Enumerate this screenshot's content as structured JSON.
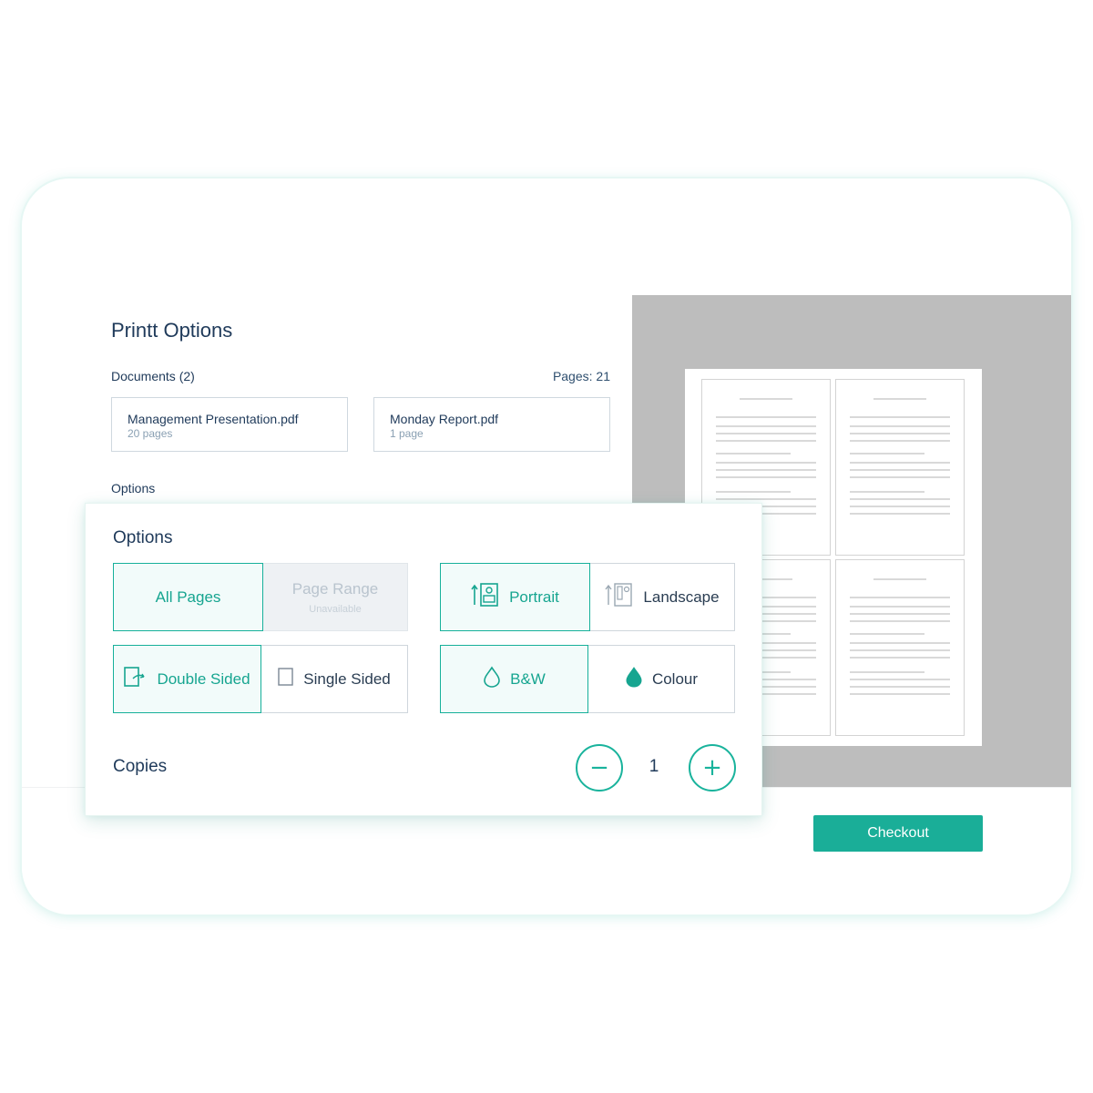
{
  "app": {
    "title": "Printt Options"
  },
  "documents": {
    "label": "Documents (2)",
    "pages_total": "Pages: 21",
    "items": [
      {
        "name": "Management Presentation.pdf",
        "pages": "20 pages"
      },
      {
        "name": "Monday Report.pdf",
        "pages": "1 page"
      }
    ]
  },
  "options_section_label": "Options",
  "options_panel": {
    "title": "Options",
    "page_selection": {
      "all_pages": "All Pages",
      "page_range": "Page Range",
      "page_range_note": "Unavailable",
      "selected": "All Pages"
    },
    "orientation": {
      "portrait": "Portrait",
      "landscape": "Landscape",
      "selected": "Portrait"
    },
    "sides": {
      "double": "Double Sided",
      "single": "Single Sided",
      "selected": "Double Sided"
    },
    "color_mode": {
      "bw": "B&W",
      "colour": "Colour",
      "selected": "B&W"
    },
    "copies": {
      "label": "Copies",
      "value": "1",
      "decrement_symbol": "−",
      "increment_symbol": "+"
    }
  },
  "checkout_label": "Checkout",
  "colors": {
    "accent": "#1aae98",
    "text": "#1f3a5a",
    "preview_bg": "#bdbdbd"
  },
  "icons": [
    "portrait-orientation-icon",
    "landscape-orientation-icon",
    "double-sided-icon",
    "single-sided-checkbox-icon",
    "bw-drop-icon",
    "colour-drop-icon",
    "minus-icon",
    "plus-icon"
  ]
}
